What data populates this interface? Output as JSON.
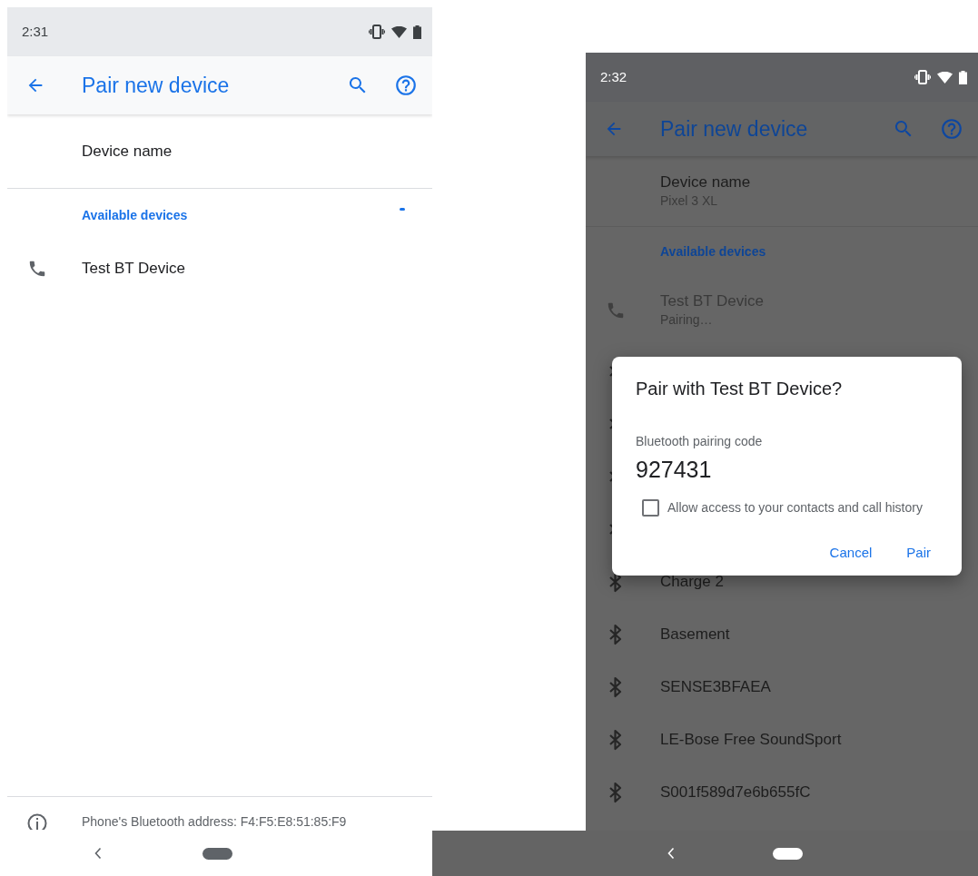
{
  "screens": [
    {
      "kind": "light",
      "status_bar": {
        "time": "2:31"
      },
      "toolbar": {
        "title": "Pair new device"
      },
      "device_name": {
        "label": "Device name"
      },
      "section": {
        "title": "Available devices",
        "scanning": true
      },
      "devices": [
        {
          "kind": "phone",
          "name": "Test BT Device",
          "disabled": false
        }
      ],
      "footer": {
        "text": "Phone's Bluetooth address: F4:F5:E8:51:85:F9"
      }
    },
    {
      "kind": "dimmed",
      "status_bar": {
        "time": "2:32"
      },
      "toolbar": {
        "title": "Pair new device"
      },
      "device_name": {
        "label": "Device name",
        "value": "Pixel 3 XL"
      },
      "section": {
        "title": "Available devices",
        "scanning": false
      },
      "devices": [
        {
          "kind": "phone",
          "name": "Test BT Device",
          "status": "Pairing…",
          "disabled": true
        },
        {
          "kind": "bluetooth",
          "covered": true
        },
        {
          "kind": "bluetooth",
          "covered": true
        },
        {
          "kind": "bluetooth",
          "covered": true
        },
        {
          "kind": "bluetooth",
          "covered": true
        },
        {
          "kind": "bluetooth",
          "name": "Charge 2",
          "disabled": false
        },
        {
          "kind": "bluetooth",
          "name": "Basement",
          "disabled": false
        },
        {
          "kind": "bluetooth",
          "name": "SENSE3BFAEA",
          "disabled": false
        },
        {
          "kind": "bluetooth",
          "name": "LE-Bose Free SoundSport",
          "disabled": false
        },
        {
          "kind": "bluetooth",
          "name": "S001f589d7e6b655fC",
          "disabled": false
        }
      ],
      "dialog": {
        "title": "Pair with Test BT Device?",
        "code_label": "Bluetooth pairing code",
        "code": "927431",
        "checkbox": {
          "label": "Allow access to your contacts and call history",
          "checked": false
        },
        "buttons": [
          "Cancel",
          "Pair"
        ]
      }
    }
  ]
}
